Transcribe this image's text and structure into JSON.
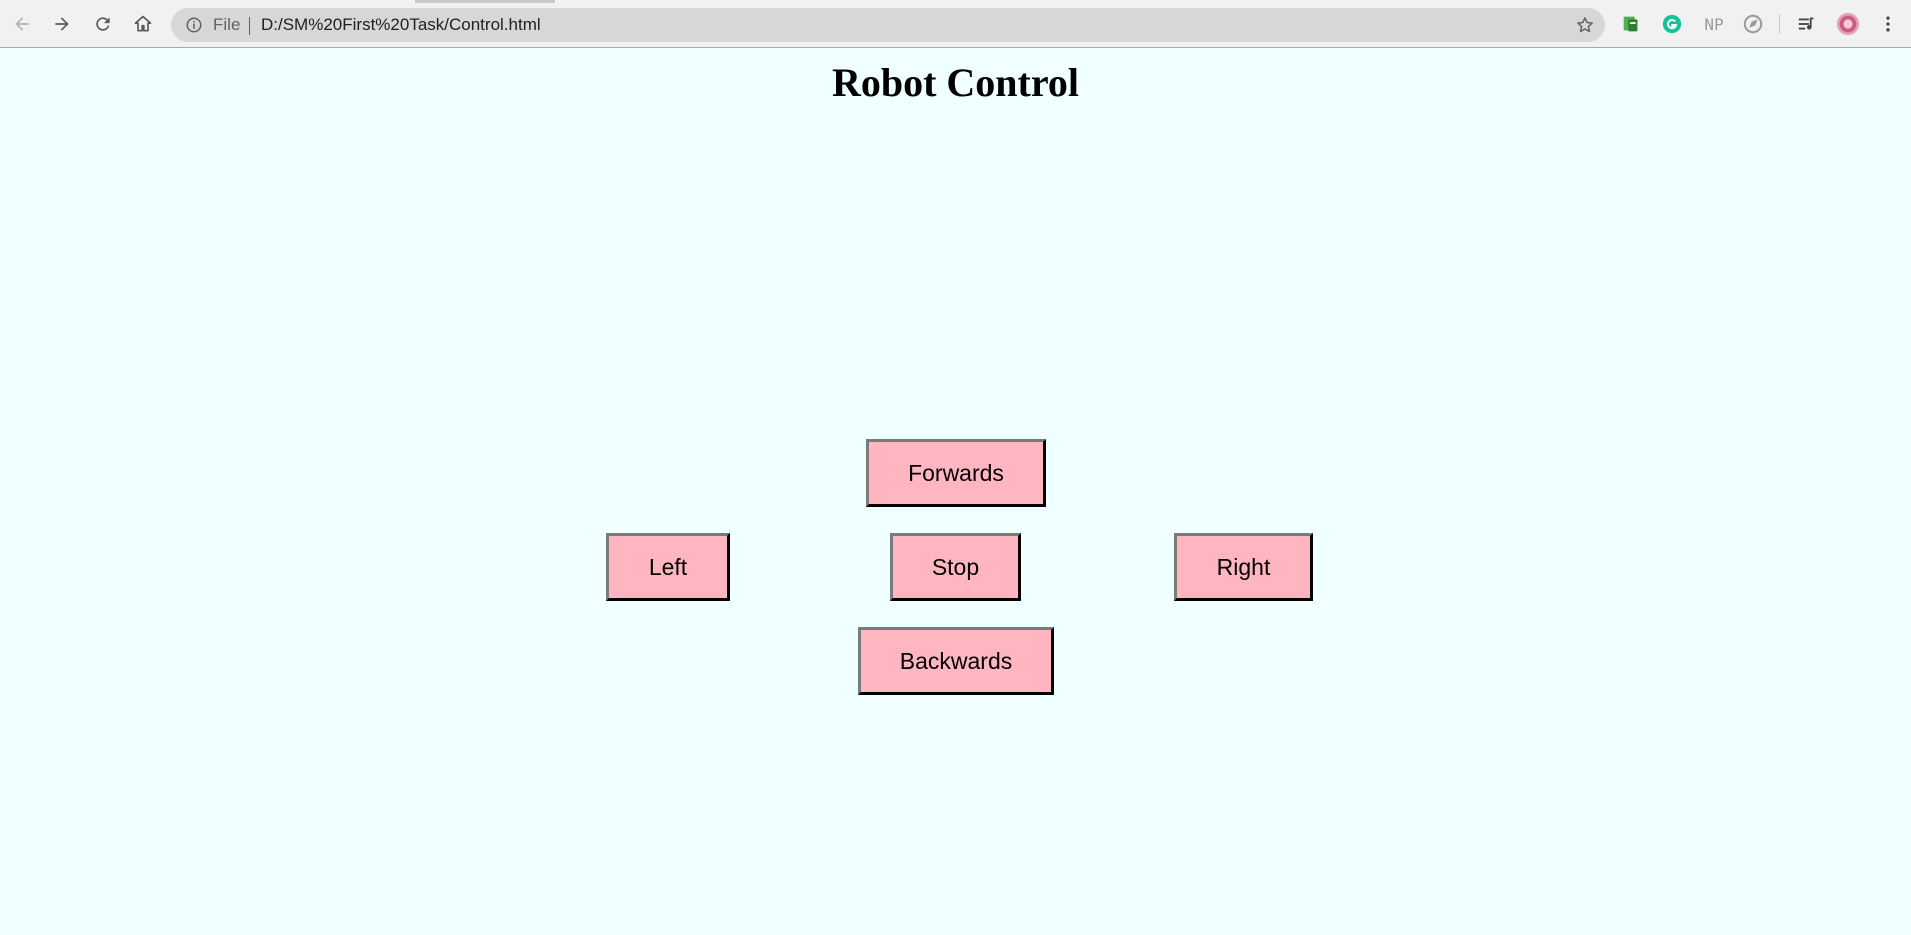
{
  "browser": {
    "address_bar": {
      "scheme_label": "File",
      "url": "D:/SM%20First%20Task/Control.html"
    },
    "nav_icons": [
      "back-arrow-icon",
      "forward-arrow-icon",
      "reload-icon",
      "home-icon"
    ],
    "extension_icons": [
      "extension-icon",
      "grammarly-icon",
      "np-extension-icon",
      "compass-extension-icon",
      "media-controls-icon",
      "profile-avatar-icon",
      "menu-icon"
    ],
    "extensions": {
      "np_label": "NP"
    }
  },
  "page": {
    "title": "Robot Control",
    "background_color": "#f0ffff",
    "button_color": "#ffb6c1",
    "controls": {
      "forwards": "Forwards",
      "left": "Left",
      "stop": "Stop",
      "right": "Right",
      "backwards": "Backwards"
    }
  }
}
